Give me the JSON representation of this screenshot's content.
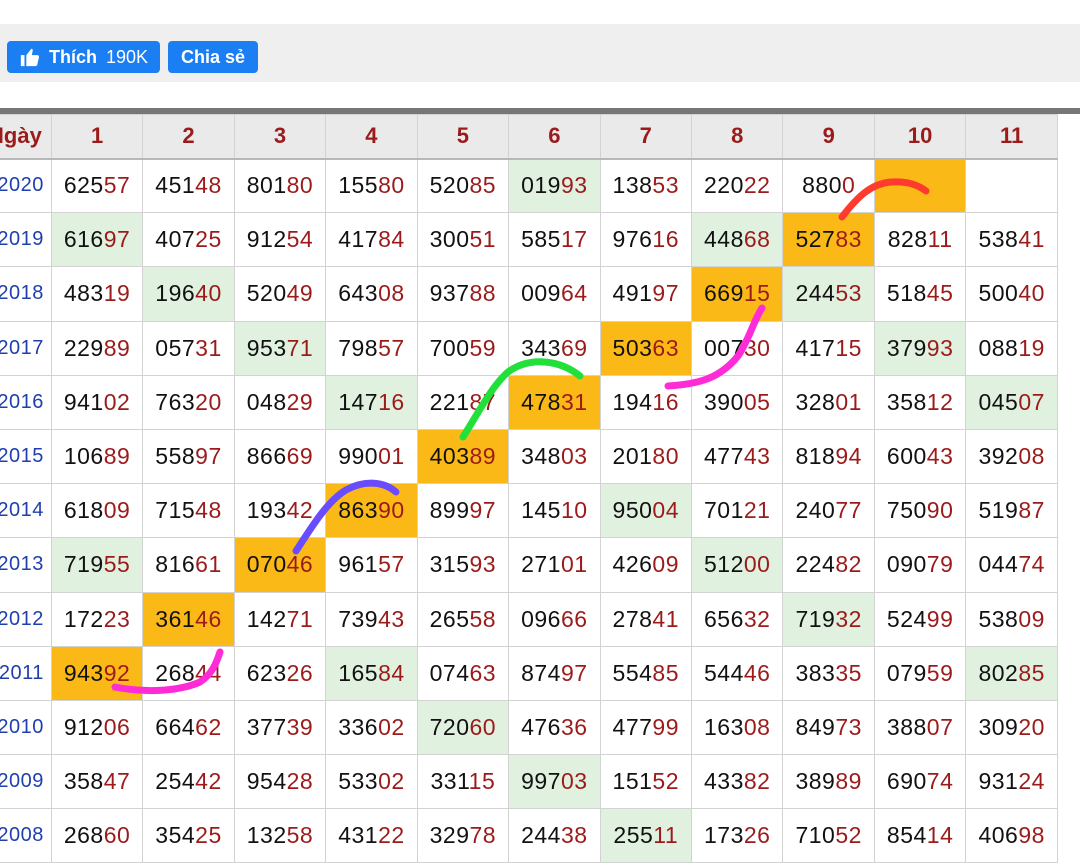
{
  "toolbar": {
    "like_label": "Thích",
    "like_count": "190K",
    "share_label": "Chia sẻ"
  },
  "table": {
    "headers": [
      "Ngày",
      "1",
      "2",
      "3",
      "4",
      "5",
      "6",
      "7",
      "8",
      "9",
      "10",
      "11"
    ],
    "rows": [
      {
        "label": "2020",
        "cells": [
          "62557",
          "45148",
          "80180",
          "15580",
          "52085",
          "01993",
          "13853",
          "22022",
          "8800",
          ""
        ]
      },
      {
        "label": "2019",
        "cells": [
          "61697",
          "40725",
          "91254",
          "41784",
          "30051",
          "58517",
          "97616",
          "44868",
          "52783",
          "82811",
          "53841"
        ]
      },
      {
        "label": "2018",
        "cells": [
          "48319",
          "19640",
          "52049",
          "64308",
          "93788",
          "00964",
          "49197",
          "66915",
          "24453",
          "51845",
          "50040"
        ]
      },
      {
        "label": "2017",
        "cells": [
          "22989",
          "05731",
          "95371",
          "79857",
          "70059",
          "34369",
          "50363",
          "00730",
          "41715",
          "37993",
          "08819"
        ]
      },
      {
        "label": "2016",
        "cells": [
          "94102",
          "76320",
          "04829",
          "14716",
          "22187",
          "47831",
          "19416",
          "39005",
          "32801",
          "35812",
          "04507"
        ]
      },
      {
        "label": "2015",
        "cells": [
          "10689",
          "55897",
          "86669",
          "99001",
          "40389",
          "34803",
          "20180",
          "47743",
          "81894",
          "60043",
          "39208"
        ]
      },
      {
        "label": "2014",
        "cells": [
          "61809",
          "71548",
          "19342",
          "86390",
          "89997",
          "14510",
          "95004",
          "70121",
          "24077",
          "75090",
          "51987"
        ]
      },
      {
        "label": "2013",
        "cells": [
          "71955",
          "81661",
          "07046",
          "96157",
          "31593",
          "27101",
          "42609",
          "51200",
          "22482",
          "09079",
          "04474"
        ]
      },
      {
        "label": "2012",
        "cells": [
          "17223",
          "36146",
          "14271",
          "73943",
          "26558",
          "09666",
          "27841",
          "65632",
          "71932",
          "52499",
          "53809"
        ]
      },
      {
        "label": "2011",
        "cells": [
          "94392",
          "26844",
          "62326",
          "16584",
          "07463",
          "87497",
          "55485",
          "54446",
          "38335",
          "07959",
          "80285"
        ]
      },
      {
        "label": "2010",
        "cells": [
          "91206",
          "66462",
          "37739",
          "33602",
          "72060",
          "47636",
          "47799",
          "16308",
          "84973",
          "38807",
          "30920"
        ]
      },
      {
        "label": "2009",
        "cells": [
          "35847",
          "25442",
          "95428",
          "53302",
          "33115",
          "99703",
          "15152",
          "43382",
          "38989",
          "69074",
          "93124"
        ]
      },
      {
        "label": "2008",
        "cells": [
          "26860",
          "35425",
          "13258",
          "43122",
          "32978",
          "24438",
          "25511",
          "17326",
          "71052",
          "85414",
          "40698"
        ]
      }
    ],
    "highlights": {
      "green": [
        [
          0,
          5
        ],
        [
          1,
          0
        ],
        [
          1,
          7
        ],
        [
          2,
          1
        ],
        [
          2,
          8
        ],
        [
          3,
          2
        ],
        [
          3,
          9
        ],
        [
          4,
          3
        ],
        [
          4,
          10
        ],
        [
          6,
          6
        ],
        [
          7,
          0
        ],
        [
          7,
          7
        ],
        [
          8,
          8
        ],
        [
          9,
          3
        ],
        [
          9,
          10
        ],
        [
          10,
          4
        ],
        [
          11,
          5
        ],
        [
          12,
          6
        ]
      ],
      "orange": [
        [
          0,
          9
        ],
        [
          1,
          8
        ],
        [
          2,
          7
        ],
        [
          3,
          6
        ],
        [
          4,
          5
        ],
        [
          5,
          4
        ],
        [
          6,
          3
        ],
        [
          7,
          2
        ],
        [
          8,
          1
        ],
        [
          9,
          0
        ]
      ]
    }
  },
  "annotations": {
    "colors": {
      "red": "#ff3b30",
      "magenta": "#ff2bd6",
      "green": "#22e03a",
      "purple": "#6a4cff"
    }
  }
}
